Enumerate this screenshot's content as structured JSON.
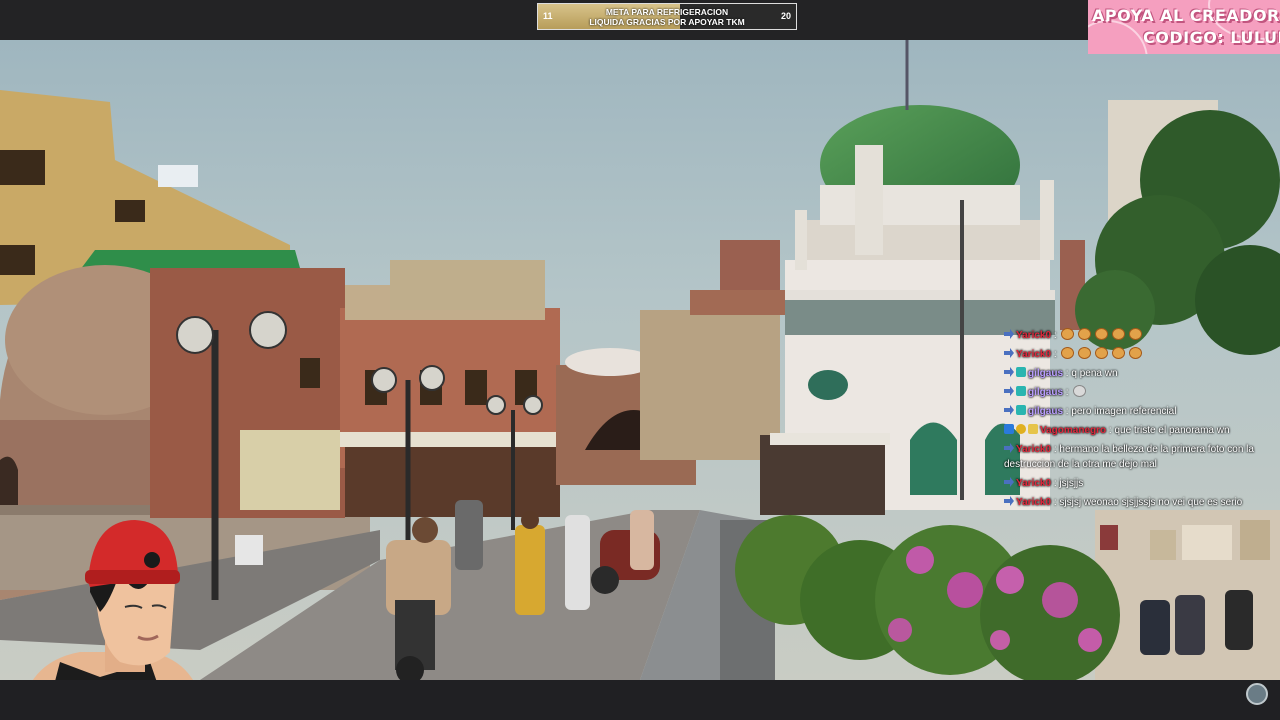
{
  "goal": {
    "start_value": "11",
    "end_value": "20",
    "progress": 0.55,
    "line1": "META PARA REFRIGERACION",
    "line2": "LIQUIDA GRACIAS POR APOYAR TKM"
  },
  "creator_banner": {
    "line1": "APOYA AL CREADOR",
    "line2": "CODIGO: LULUI"
  },
  "chat": {
    "messages": [
      {
        "user": "Yarick0",
        "user_color": "#e0283c",
        "badges": [
          "arrow"
        ],
        "text": "",
        "emotes": 5,
        "emote_kind": "emote-orange"
      },
      {
        "user": "Yarick0",
        "user_color": "#e0283c",
        "badges": [
          "arrow"
        ],
        "text": "",
        "emotes": 5,
        "emote_kind": "emote-orange"
      },
      {
        "user": "gilgaus",
        "user_color": "#b89cff",
        "badges": [
          "arrow",
          "sub"
        ],
        "text": "q pena wn",
        "emotes": 0
      },
      {
        "user": "gilgaus",
        "user_color": "#b89cff",
        "badges": [
          "arrow",
          "sub"
        ],
        "text": "",
        "emotes": 1,
        "emote_kind": "emote-face"
      },
      {
        "user": "gilgaus",
        "user_color": "#b89cff",
        "badges": [
          "arrow",
          "sub"
        ],
        "text": "pero imagen referencial",
        "emotes": 0
      },
      {
        "user": "Vagomanegro",
        "user_color": "#e0283c",
        "badges": [
          "prime",
          "gold",
          "star"
        ],
        "text": "que triste el panorama wn",
        "emotes": 0
      },
      {
        "user": "Yarick0",
        "user_color": "#e0283c",
        "badges": [
          "arrow"
        ],
        "text": "hermano la belleza de la primera foto con la destruccion de la otra me dejo mal",
        "emotes": 0,
        "wrap": true
      },
      {
        "user": "Yarick0",
        "user_color": "#e0283c",
        "badges": [
          "arrow"
        ],
        "text": "jsjsjjs",
        "emotes": 0
      },
      {
        "user": "Yarick0",
        "user_color": "#e0283c",
        "badges": [
          "arrow"
        ],
        "text": "sjsjsj weonao sjsjjssjs no vei que es serio",
        "emotes": 0
      }
    ]
  }
}
